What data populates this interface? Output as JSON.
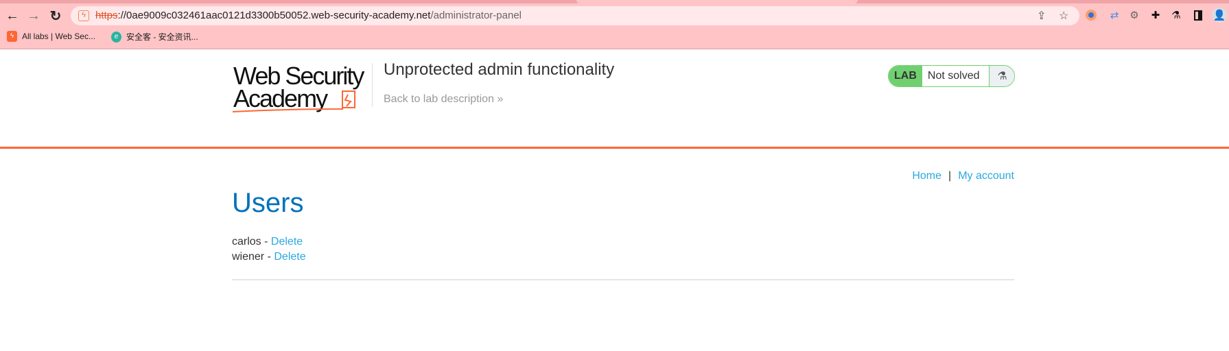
{
  "browser": {
    "url_scheme": "https",
    "url_host": "://0ae9009c032461aac0121d3300b50052.web-security-academy.net",
    "url_path": "/administrator-panel",
    "bookmarks": [
      {
        "label": "All labs | Web Sec...",
        "icon": "portswigger-icon",
        "color": "#ff6633"
      },
      {
        "label": "安全客 - 安全资讯...",
        "icon": "anquanke-icon",
        "color": "#2bb3a0"
      }
    ]
  },
  "header": {
    "logo_text": "Web Security Academy",
    "lab_title": "Unprotected admin functionality",
    "back_link": "Back to lab description",
    "back_chevron": "»",
    "badge_lab": "LAB",
    "badge_status": "Not solved"
  },
  "nav": {
    "home": "Home",
    "separator": "|",
    "account": "My account"
  },
  "main": {
    "heading": "Users",
    "users": [
      {
        "name": "carlos",
        "sep": " - ",
        "action": "Delete"
      },
      {
        "name": "wiener",
        "sep": " - ",
        "action": "Delete"
      }
    ]
  },
  "colors": {
    "accent": "#ff6633",
    "link": "#29a9e0",
    "heading": "#0071bc",
    "lab_green": "#70d070"
  }
}
